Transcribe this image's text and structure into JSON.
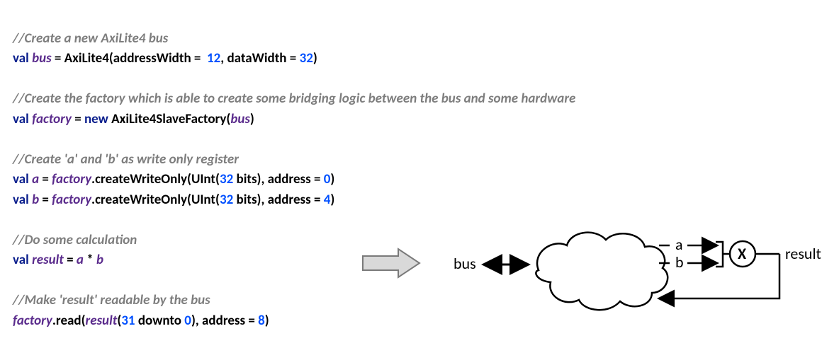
{
  "code": {
    "c1": "//Create a new AxiLite4 bus",
    "l2a": "val ",
    "l2b": "bus",
    "l2c": " = AxiLite4(addressWidth =  ",
    "l2d": "12",
    "l2e": ", dataWidth = ",
    "l2f": "32",
    "l2g": ")",
    "c3": "//Create the factory which is able to create some bridging logic between the bus and some hardware",
    "l4a": "val ",
    "l4b": "factory",
    "l4c": " = ",
    "l4d": "new ",
    "l4e": "AxiLite4SlaveFactory(",
    "l4f": "bus",
    "l4g": ")",
    "c5": "//Create 'a' and 'b' as write only register",
    "l6a": "val ",
    "l6b": "a",
    "l6c": " = ",
    "l6d": "factory",
    "l6e": ".createWriteOnly(UInt(",
    "l6f": "32",
    "l6g": " bits), address = ",
    "l6h": "0",
    "l6i": ")",
    "l7a": "val ",
    "l7b": "b",
    "l7c": " = ",
    "l7d": "factory",
    "l7e": ".createWriteOnly(UInt(",
    "l7f": "32",
    "l7g": " bits), address = ",
    "l7h": "4",
    "l7i": ")",
    "c8": "//Do some calculation",
    "l9a": "val ",
    "l9b": "result",
    "l9c": " = ",
    "l9d": "a",
    "l9e": " * ",
    "l9f": "b",
    "c10": "//Make 'result' readable by the bus",
    "l11a": "factory",
    "l11b": ".read(",
    "l11c": "result",
    "l11d": "(",
    "l11e": "31",
    "l11f": " downto ",
    "l11g": "0",
    "l11h": "), address = ",
    "l11i": "8",
    "l11j": ")"
  },
  "diagram": {
    "bus": "bus",
    "a": "a",
    "b": "b",
    "x": "X",
    "result": "result"
  }
}
